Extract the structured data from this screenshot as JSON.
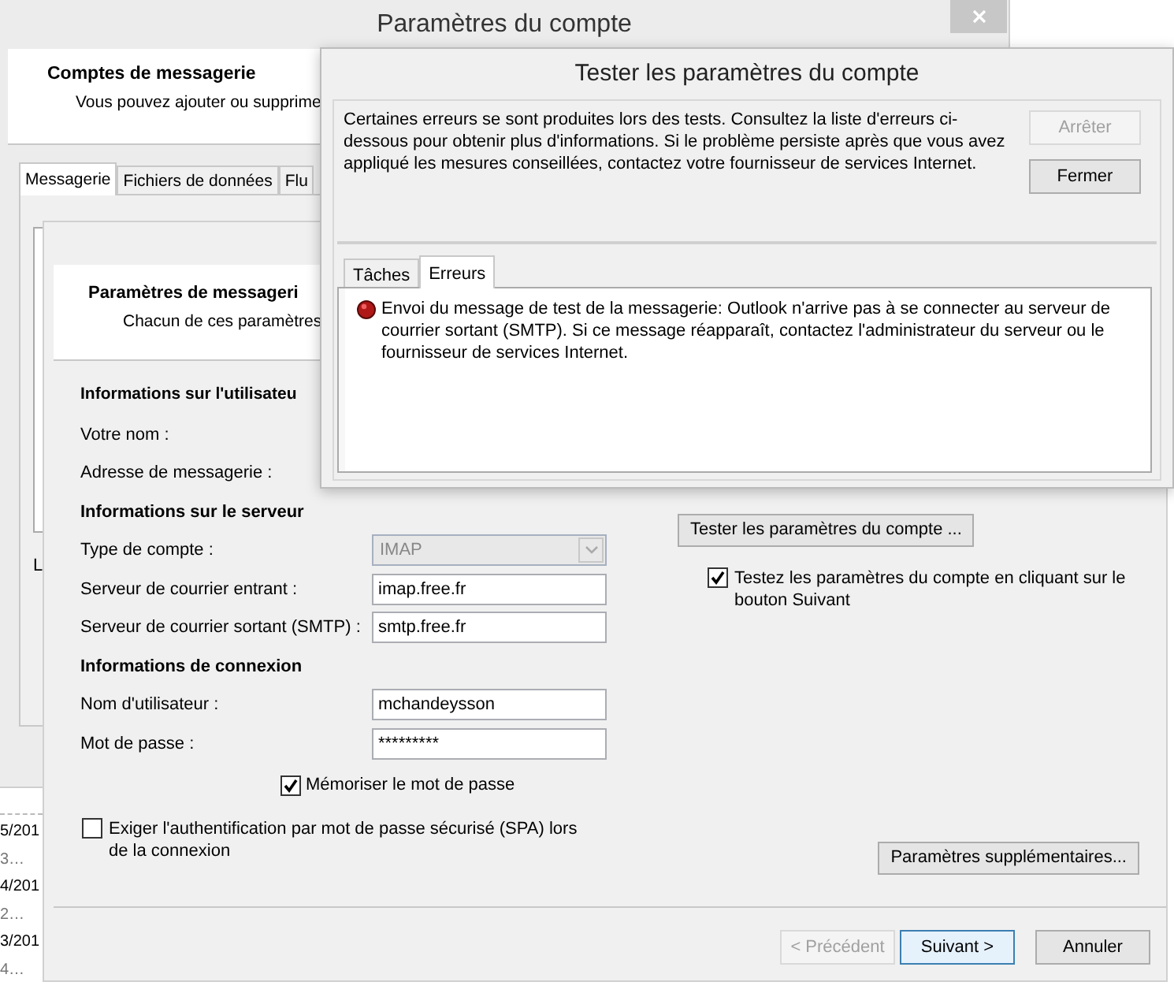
{
  "account_window": {
    "title": "Paramètres du compte",
    "header_title": "Comptes de messagerie",
    "header_subtitle": "Vous pouvez ajouter ou supprime",
    "tabs": [
      {
        "label": "Messagerie",
        "selected": true
      },
      {
        "label": "Fichiers de données",
        "selected": false
      },
      {
        "label": "Flu",
        "selected": false
      }
    ],
    "fragment": "L"
  },
  "message_list": [
    {
      "text": "5/201",
      "kind": "date"
    },
    {
      "text": "3…",
      "kind": "preview"
    },
    {
      "text": "4/201",
      "kind": "date"
    },
    {
      "text": "2…",
      "kind": "preview"
    },
    {
      "text": "3/201",
      "kind": "date"
    },
    {
      "text": "4…",
      "kind": "preview"
    }
  ],
  "wizard": {
    "header_title": "Paramètres de messageri",
    "header_subtitle": "Chacun de ces paramètres",
    "form": [
      {
        "kind": "heading",
        "text": "Informations sur l'utilisateu"
      },
      {
        "kind": "label",
        "label": "Votre nom :"
      },
      {
        "kind": "label",
        "label": "Adresse de messagerie :"
      },
      {
        "kind": "heading",
        "text": "Informations sur le serveur"
      },
      {
        "kind": "combo",
        "label": "Type de compte :",
        "value": "IMAP",
        "disabled": true
      },
      {
        "kind": "field",
        "label": "Serveur de courrier entrant :",
        "value": "imap.free.fr"
      },
      {
        "kind": "field",
        "label": "Serveur de courrier sortant (SMTP) :",
        "value": "smtp.free.fr"
      },
      {
        "kind": "heading",
        "text": "Informations de connexion"
      },
      {
        "kind": "field",
        "label": "Nom d'utilisateur :",
        "value": "mchandeysson"
      },
      {
        "kind": "field",
        "label": "Mot de passe :",
        "value": "*********"
      }
    ],
    "remember_password": {
      "label": "Mémoriser le mot de passe",
      "checked": true
    },
    "spa": {
      "label": "Exiger l'authentification par mot de passe sécurisé (SPA) lors de la connexion",
      "checked": false
    },
    "test_button": "Tester les paramètres du compte ...",
    "test_on_next": {
      "label": "Testez les paramètres du compte en cliquant sur le bouton Suivant",
      "checked": true
    },
    "more_settings_button": "Paramètres supplémentaires...",
    "footer_buttons": [
      {
        "label": "< Précédent",
        "disabled": true,
        "default": false
      },
      {
        "label": "Suivant >",
        "disabled": false,
        "default": true
      },
      {
        "label": "Annuler",
        "disabled": false,
        "default": false
      }
    ]
  },
  "test_dialog": {
    "title": "Tester les paramètres du compte",
    "message": "Certaines erreurs se sont produites lors des tests. Consultez la liste d'erreurs ci-dessous pour obtenir plus d'informations. Si le problème persiste après que vous avez appliqué les mesures conseillées, contactez votre fournisseur de services Internet.",
    "buttons": [
      {
        "label": "Arrêter",
        "disabled": true
      },
      {
        "label": "Fermer",
        "disabled": false
      }
    ],
    "tabs": [
      {
        "label": "Tâches",
        "selected": false
      },
      {
        "label": "Erreurs",
        "selected": true
      }
    ],
    "errors": [
      {
        "text": "Envoi du message de test de la messagerie: Outlook n'arrive pas à se connecter au serveur de courrier sortant (SMTP). Si ce message réapparaît, contactez l'administrateur du serveur ou le fournisseur de services Internet."
      }
    ]
  }
}
